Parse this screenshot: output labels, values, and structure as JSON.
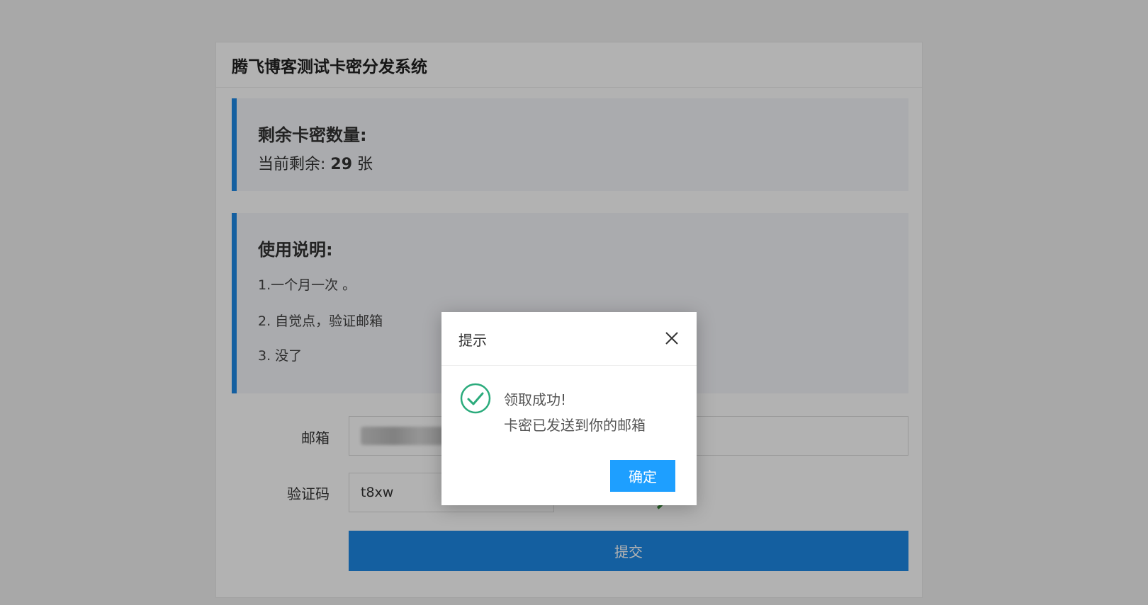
{
  "app": {
    "title": "腾飞博客测试卡密分发系统"
  },
  "stock": {
    "heading": "剩余卡密数量:",
    "prefix": "当前剩余:",
    "count": "29",
    "unit": "张"
  },
  "instructions": {
    "heading": "使用说明:",
    "items": [
      "1.一个月一次 。",
      "2. 自觉点，验证邮箱",
      "3. 没了"
    ]
  },
  "form": {
    "email_label": "邮箱",
    "captcha_label": "验证码",
    "captcha_value": "t8xw",
    "submit_label": "提交"
  },
  "dialog": {
    "title": "提示",
    "message_line1": "领取成功!",
    "message_line2": "卡密已发送到你的邮箱",
    "confirm_label": "确定"
  },
  "colors": {
    "accent": "#1e88e5",
    "dialog_button": "#1e9fff",
    "success": "#2bab7c"
  }
}
